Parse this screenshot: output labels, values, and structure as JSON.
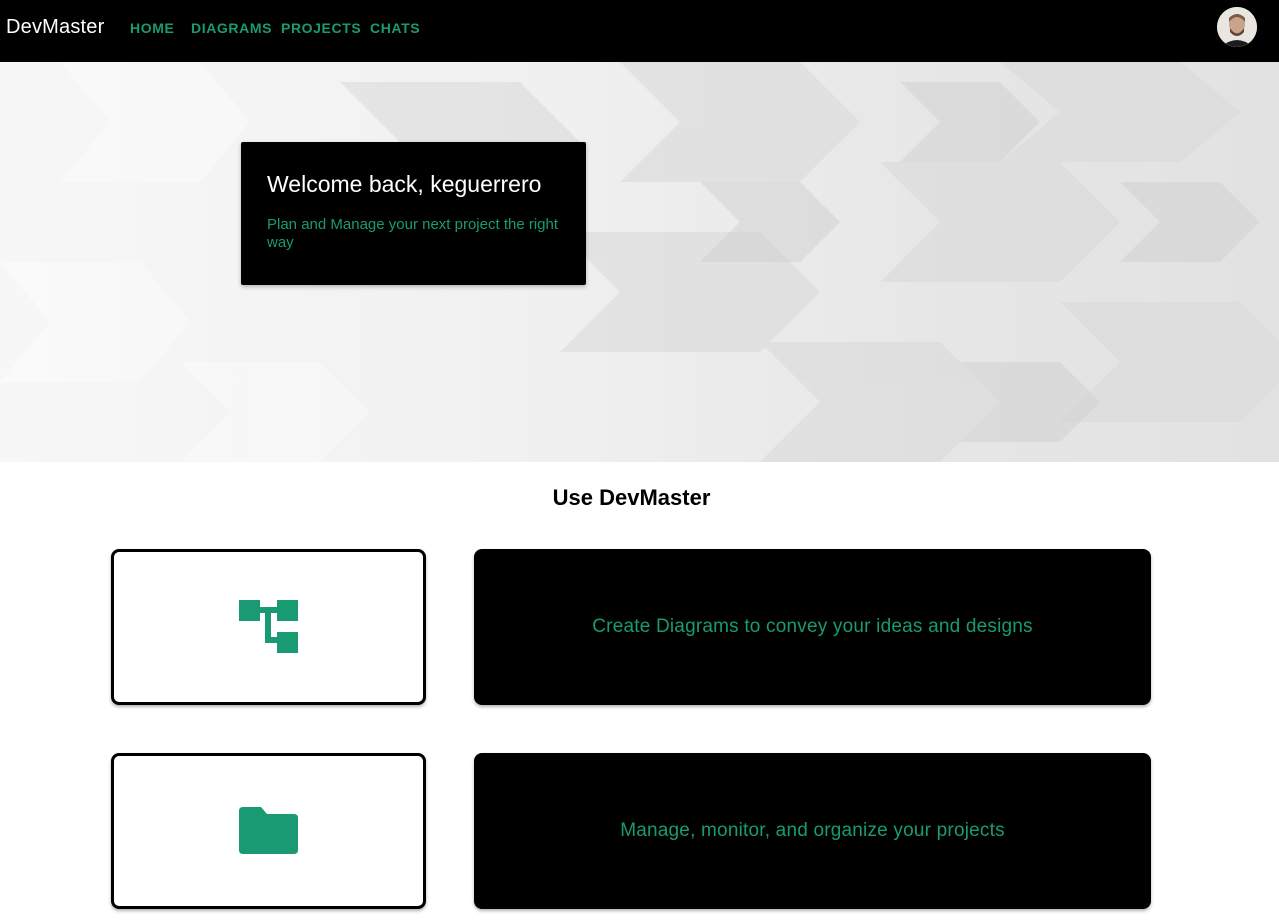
{
  "header": {
    "brand": "DevMaster",
    "nav": [
      {
        "label": "HOME"
      },
      {
        "label": "DIAGRAMS"
      },
      {
        "label": "PROJECTS"
      },
      {
        "label": "CHATS"
      }
    ],
    "avatar_icon": "user-avatar"
  },
  "hero": {
    "title": "Welcome back, keguerrero",
    "subtitle": "Plan and Manage your next project the right way"
  },
  "section": {
    "title": "Use DevMaster",
    "features": [
      {
        "icon": "diagram-tree-icon",
        "label": "Create Diagrams to convey your ideas and designs"
      },
      {
        "icon": "folder-icon",
        "label": "Manage, monitor, and organize your projects"
      }
    ]
  },
  "colors": {
    "accent": "#1a9a72",
    "bar": "#000000"
  }
}
